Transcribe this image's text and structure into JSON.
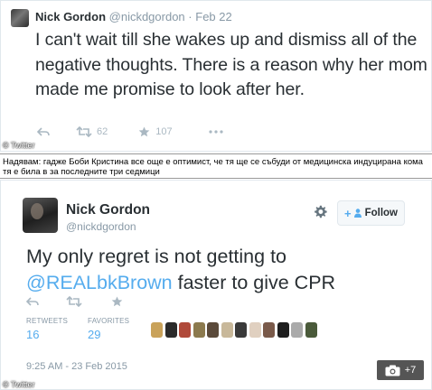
{
  "top_tweet": {
    "name": "Nick Gordon",
    "handle": "@nickdgordon",
    "separator": "·",
    "date": "Feb 22",
    "text": "I can't wait till she wakes up and dismiss all of the negative thoughts. There is a reason why her mom made me promise to look after her.",
    "retweets": "62",
    "favorites": "107",
    "credit": "© Twitter"
  },
  "caption": {
    "text": "Надявам: гадже Боби Кристина все още е оптимист, че тя ще се събуди от медицинска индуцирана кома тя е била в за последните три седмици"
  },
  "bottom_tweet": {
    "name": "Nick Gordon",
    "handle": "@nickdgordon",
    "follow_label": "Follow",
    "text_before": "My only regret is not getting to ",
    "mention": "@REALbkBrown",
    "text_after": " faster to give CPR",
    "retweets_label": "RETWEETS",
    "retweets_value": "16",
    "favorites_label": "FAVORITES",
    "favorites_value": "29",
    "timestamp": "9:25 AM - 23 Feb 2015",
    "photo_count": "+7",
    "credit": "© Twitter"
  },
  "icons": {
    "reply": "reply-icon",
    "retweet": "retweet-icon",
    "favorite": "star-icon",
    "more": "more-icon",
    "settings": "gear-icon",
    "camera": "camera-icon"
  },
  "colors": {
    "link": "#55acee",
    "muted": "#8899a6",
    "text": "#292f33",
    "border": "#e1e8ed"
  },
  "favoriter_avatar_colors": [
    "#c9a25a",
    "#2b2b2b",
    "#b04a3a",
    "#8c7a4e",
    "#5b4a3a",
    "#c8b89a",
    "#3a3a3a",
    "#e0d0c0",
    "#7a5a4a",
    "#1e1e1e",
    "#aaaaaa",
    "#4a5a3a"
  ]
}
